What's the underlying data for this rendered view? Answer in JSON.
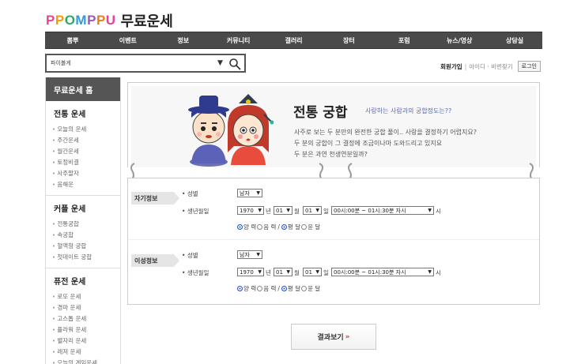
{
  "header": {
    "logo_letters": [
      "P",
      "P",
      "O",
      "M",
      "P",
      "P",
      "U"
    ],
    "logo_colors": [
      "#e84393",
      "#f39c12",
      "#27ae60",
      "#3498db",
      "#9b59b6",
      "#e67e22",
      "#e84393"
    ],
    "page_title": "무료운세"
  },
  "nav": {
    "items": [
      "뽐뿌",
      "이벤트",
      "정보",
      "커뮤니티",
      "갤러리",
      "장터",
      "포럼",
      "뉴스/영상",
      "상담실"
    ]
  },
  "search": {
    "value": "파이볼게",
    "arrow": "▼",
    "icon": "search-icon"
  },
  "userlinks": {
    "join": "회원가입",
    "sep": "|",
    "find": "아이디 · 비번찾기",
    "login": "로그인"
  },
  "sidebar": {
    "home": "무료운세 홈",
    "sections": [
      {
        "heading": "전통 운세",
        "items": [
          "오늘의 운세",
          "주간운세",
          "월간운세",
          "토정비결",
          "사주팔자",
          "음해운"
        ]
      },
      {
        "heading": "커플 운세",
        "items": [
          "전통궁합",
          "속궁합",
          "혈액형 궁합",
          "첫데이트 궁합"
        ]
      },
      {
        "heading": "퓨전 운세",
        "items": [
          "로또 운세",
          "경마 운세",
          "고스톱 운세",
          "플라워 운세",
          "별자리 운세",
          "레져 운세",
          "오늘의 게임운세"
        ]
      }
    ]
  },
  "banner": {
    "title": "전통 궁합",
    "subtitle": "사랑하는 사람과의 궁합정도는??",
    "lines": [
      "사주로 보는 두 분만의 완전한 궁합 풀이.. 사랑을 결정하기 어렵지요?",
      "두 분의 궁합이 그 결정에 조금이나마 도와드리고 있지요",
      "두 분은 과연 천생연분일까?"
    ]
  },
  "form": {
    "blocks": [
      {
        "label": "자기정보",
        "gender_label": "성별",
        "gender": "남자",
        "birth_label": "생년월일",
        "year": "1970",
        "year_unit": "년",
        "month": "01",
        "month_unit": "월",
        "day": "01",
        "day_unit": "일",
        "time": "00시:00분 ~ 01시:30분 자시",
        "time_unit": "시",
        "r1": "양 력",
        "r2": "음 력",
        "slash": "/",
        "r3": "평 달",
        "r4": "윤 달"
      },
      {
        "label": "이성정보",
        "gender_label": "성별",
        "gender": "남자",
        "birth_label": "생년월일",
        "year": "1970",
        "year_unit": "년",
        "month": "01",
        "month_unit": "월",
        "day": "01",
        "day_unit": "일",
        "time": "00시:00분 ~ 01시:30분 자시",
        "time_unit": "시",
        "r1": "양 력",
        "r2": "음 력",
        "slash": "/",
        "r3": "평 달",
        "r4": "윤 달"
      }
    ]
  },
  "result": {
    "label": "결과보기",
    "chev": "»"
  }
}
